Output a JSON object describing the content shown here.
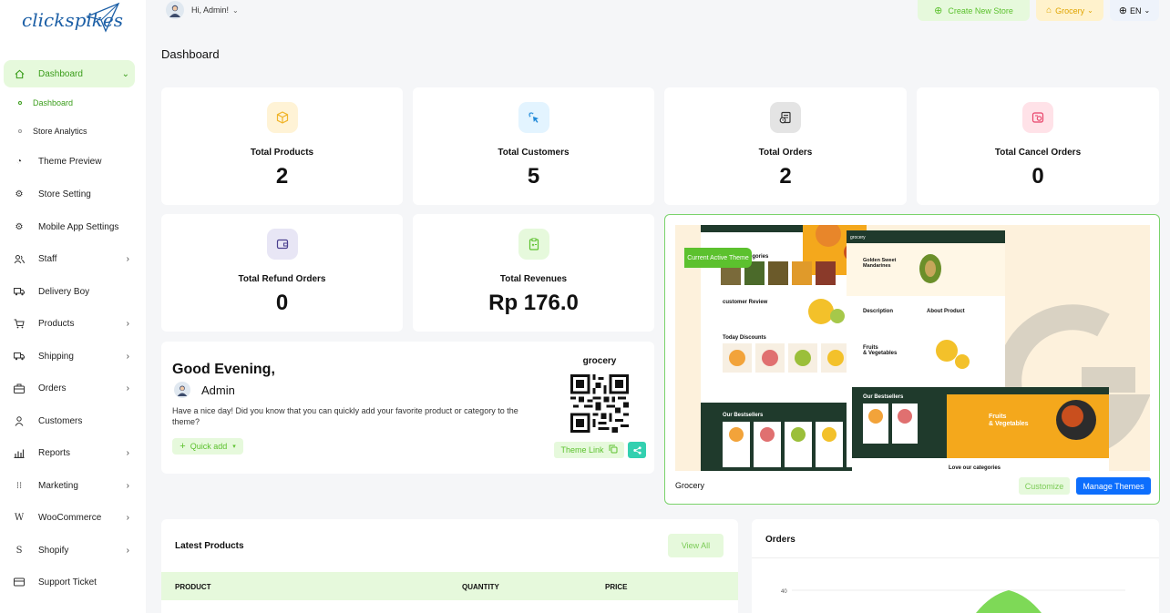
{
  "brand": {
    "logo_text": "clickspikes"
  },
  "topbar": {
    "greeting": "Hi, Admin!",
    "create_store": "Create New Store",
    "store_selector": "Grocery",
    "language": "EN"
  },
  "sidebar": {
    "items": [
      {
        "label": "Dashboard",
        "icon": "home-icon",
        "has_children": true,
        "active": true
      },
      {
        "label": "Theme Preview",
        "icon": "theme-icon",
        "has_children": false
      },
      {
        "label": "Store Setting",
        "icon": "settings-icon",
        "has_children": false
      },
      {
        "label": "Mobile App Settings",
        "icon": "mobile-settings-icon",
        "has_children": false
      },
      {
        "label": "Staff",
        "icon": "staff-icon",
        "has_children": true
      },
      {
        "label": "Delivery Boy",
        "icon": "truck-icon",
        "has_children": false
      },
      {
        "label": "Products",
        "icon": "cart-icon",
        "has_children": true
      },
      {
        "label": "Shipping",
        "icon": "shipping-icon",
        "has_children": true
      },
      {
        "label": "Orders",
        "icon": "orders-icon",
        "has_children": true
      },
      {
        "label": "Customers",
        "icon": "user-icon",
        "has_children": false
      },
      {
        "label": "Reports",
        "icon": "chart-icon",
        "has_children": true
      },
      {
        "label": "Marketing",
        "icon": "marketing-icon",
        "has_children": true
      },
      {
        "label": "WooCommerce",
        "icon": "woocommerce-icon",
        "has_children": true
      },
      {
        "label": "Shopify",
        "icon": "shopify-icon",
        "has_children": true
      },
      {
        "label": "Support Ticket",
        "icon": "ticket-icon",
        "has_children": false
      }
    ],
    "sub_items": [
      {
        "label": "Dashboard",
        "active": true
      },
      {
        "label": "Store Analytics",
        "active": false
      }
    ]
  },
  "page": {
    "title": "Dashboard"
  },
  "stats": [
    {
      "label": "Total Products",
      "value": "2",
      "icon": "box-icon",
      "bg": "#fff3d6",
      "color": "#f0b429"
    },
    {
      "label": "Total Customers",
      "value": "5",
      "icon": "cursor-click-icon",
      "bg": "#e3f4ff",
      "color": "#1e88d8"
    },
    {
      "label": "Total Orders",
      "value": "2",
      "icon": "order-icon",
      "bg": "#e4e4e4",
      "color": "#333333"
    },
    {
      "label": "Total Cancel Orders",
      "value": "0",
      "icon": "cancel-order-icon",
      "bg": "#ffe2e8",
      "color": "#e8436a"
    },
    {
      "label": "Total Refund Orders",
      "value": "0",
      "icon": "wallet-icon",
      "bg": "#e8e6f5",
      "color": "#4a3f8f"
    },
    {
      "label": "Total Revenues",
      "value": "Rp 176.0",
      "icon": "clipboard-icon",
      "bg": "#e6f9dc",
      "color": "#5cc12e"
    }
  ],
  "greeting_card": {
    "title": "Good Evening,",
    "name": "Admin",
    "text": "Have a nice day! Did you know that you can quickly add your favorite product or category to the theme?",
    "quick_add": "Quick add",
    "qr_label": "grocery",
    "theme_link": "Theme Link"
  },
  "theme_card": {
    "badge": "Current Active Theme",
    "name": "Grocery",
    "customize": "Customize",
    "manage": "Manage Themes",
    "preview": {
      "categories": "Love our categories",
      "review": "customer Review",
      "discounts": "Today Discounts",
      "bestsellers": "Our Bestsellers",
      "product_title": "Golden Sweet Mandarines",
      "description": "Description",
      "about": "About Product",
      "fruits": "Fruits & Vegetables",
      "brand": "grocery",
      "price": "$4.59"
    }
  },
  "latest_products": {
    "title": "Latest Products",
    "view_all": "View All",
    "columns": [
      "PRODUCT",
      "QUANTITY",
      "PRICE"
    ]
  },
  "orders_chart": {
    "title": "Orders",
    "chart_data": {
      "type": "area",
      "y_ticks": [
        40
      ],
      "series": [
        {
          "color": "#7ed957"
        }
      ]
    }
  },
  "colors": {
    "accent": "#5cc12e",
    "primary_button": "#0d6efd",
    "accent_light": "#e6f9dc"
  }
}
